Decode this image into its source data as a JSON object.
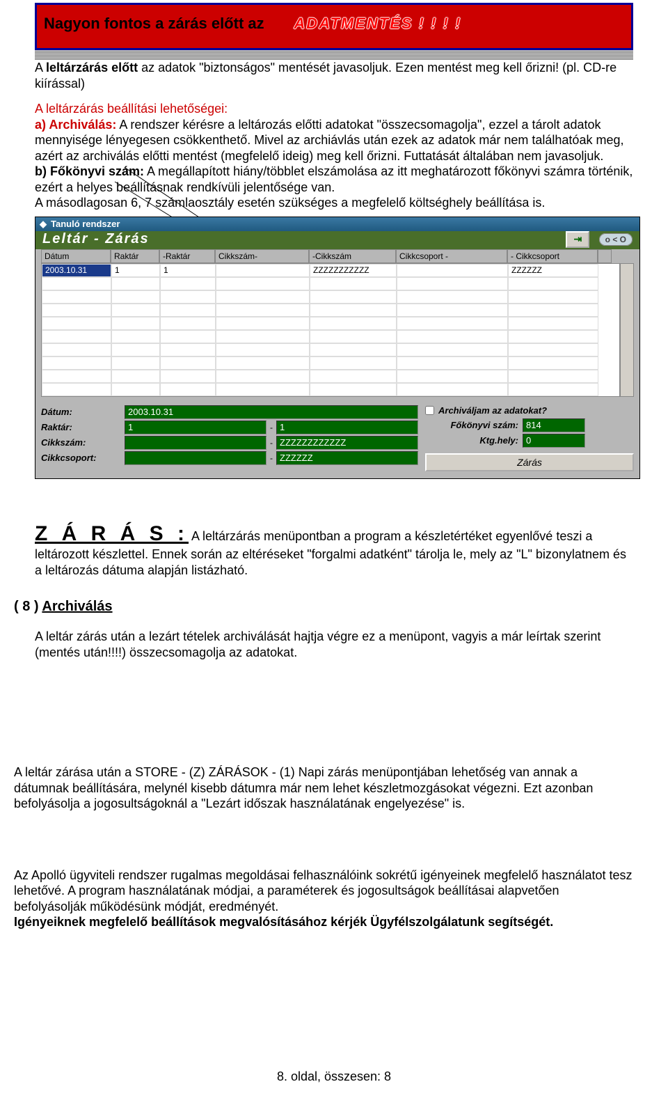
{
  "banner": {
    "prefix": "Nagyon fontos a zárás előtt az",
    "emph": "ADATMENTÉS ! ! ! !"
  },
  "intro": {
    "line1_pre": "A ",
    "line1_bold": "leltárzárás előtt",
    "line1_post": " az adatok \"biztonságos\" mentését javasoljuk. Ezen mentést meg kell őrizni! (pl. CD-re kiírással)",
    "heading2": "A leltárzárás beállítási lehetőségei:",
    "a_label": "a)  Archiválás:",
    "a_text": " A rendszer kérésre a leltározás előtti adatokat \"összecsomagolja\", ezzel a tárolt adatok mennyisége lényegesen csökkenthető. Mivel az archiávlás után ezek az adatok már nem találhatóak meg, azért az archiválás előtti mentést (megfelelő ideig) meg kell őrizni. Futtatását általában nem javasoljuk.",
    "b_label": "b) Főkönyvi szám:",
    "b_text": " A megállapított hiány/többlet elszámolása az itt meghatározott főkönyvi számra történik, ezért a helyes beállításnak rendkívüli jelentősége van.",
    "b_text2": "A másodlagosan 6, 7 számlaosztály esetén szükséges a megfelelő költséghely beállítása is."
  },
  "app": {
    "title": "Tanuló rendszer",
    "subtitle": "Leltár - Zárás",
    "close_pill": "o < O",
    "close_btn": "⇥",
    "cols": [
      "Dátum",
      "Raktár",
      "-Raktár",
      "Cikkszám-",
      "-Cikkszám",
      "Cikkcsoport -",
      "- Cikkcsoport",
      ""
    ],
    "row": {
      "datum": "2003.10.31",
      "raktar": "1",
      "raktar2": "1",
      "cikkszam": "",
      "cikkszam2": "ZZZZZZZZZZZ",
      "csoport": "",
      "csoport2": "ZZZZZZ"
    },
    "form": {
      "datum_label": "Dátum:",
      "datum": "2003.10.31",
      "raktar_label": "Raktár:",
      "raktar_from": "1",
      "raktar_to": "1",
      "cikkszam_label": "Cikkszám:",
      "cikkszam_from": "",
      "cikkszam_to": "ZZZZZZZZZZZZ",
      "csoport_label": "Cikkcsoport:",
      "csoport_from": "",
      "csoport_to": "ZZZZZZ",
      "archive_label": "Archiváljam az adatokat?",
      "fokonyvi_label": "Főkönyvi szám:",
      "fokonyvi": "814",
      "ktghely_label": "Ktg.hely:",
      "ktghely": "0",
      "zaras_btn": "Zárás"
    }
  },
  "zaras": {
    "heading": "Z Á R Á S :",
    "text": " A leltárzárás menüpontban a program a készletértéket egyenlővé teszi a leltározott készlettel. Ennek során az eltéréseket \"forgalmi adatként\" tárolja le, mely az \"L\" bizonylatnem és a leltározás dátuma alapján listázható."
  },
  "section8": {
    "num": "( 8 ) ",
    "title": "Archiválás",
    "p1": "A leltár zárás után a lezárt tételek archiválását hajtja végre ez a menüpont, vagyis a már leírtak szerint (mentés után!!!!) összecsomagolja az adatokat."
  },
  "p_store": "A leltár zárása után a STORE - (Z) ZÁRÁSOK - (1) Napi zárás menüpontjában lehetőség van annak a dátumnak beállítására, melynél kisebb dátumra már nem lehet készletmozgásokat végezni. Ezt azonban befolyásolja a jogosultságoknál a \"Lezárt időszak használatának engelyezése\" is.",
  "p_apollo1": "Az Apolló ügyviteli rendszer rugalmas megoldásai felhasználóink sokrétű igényeinek megfelelő használatot tesz lehetővé. A program használatának módjai, a paraméterek és jogosultságok beállításai alapvetően befolyásolják működésünk módját, eredményét.",
  "p_apollo2": "Igényeiknek megfelelő beállítások megvalósításához kérjék Ügyfélszolgálatunk segítségét.",
  "footer": "8. oldal, összesen: 8"
}
